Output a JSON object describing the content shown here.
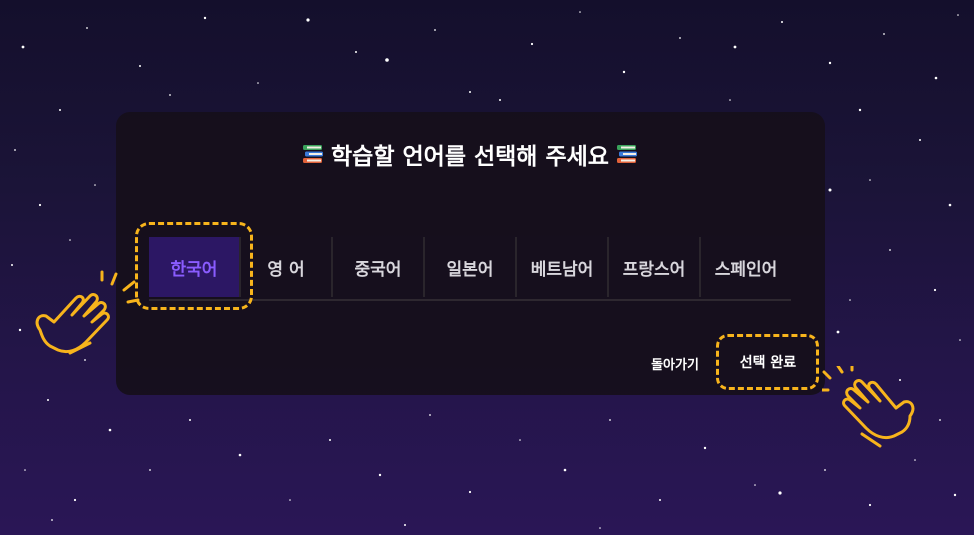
{
  "dialog": {
    "title": "학습할 언어를 선택해 주세요",
    "title_icon": "books-icon"
  },
  "languages": {
    "selected": "한국어",
    "tabs": [
      {
        "label": "한국어",
        "active": true
      },
      {
        "label": "영 어",
        "active": false
      },
      {
        "label": "중국어",
        "active": false
      },
      {
        "label": "일본어",
        "active": false
      },
      {
        "label": "베트남어",
        "active": false
      },
      {
        "label": "프랑스어",
        "active": false
      },
      {
        "label": "스페인어",
        "active": false
      }
    ]
  },
  "actions": {
    "back_label": "돌아가기",
    "done_label": "선택 완료"
  },
  "colors": {
    "accent": "#8a5cff",
    "active_tab_bg": "#2c1764",
    "highlight": "#f7b41c",
    "panel": "#160f1a"
  },
  "annotations": {
    "hand_icon": "pointing-hand-icon"
  }
}
